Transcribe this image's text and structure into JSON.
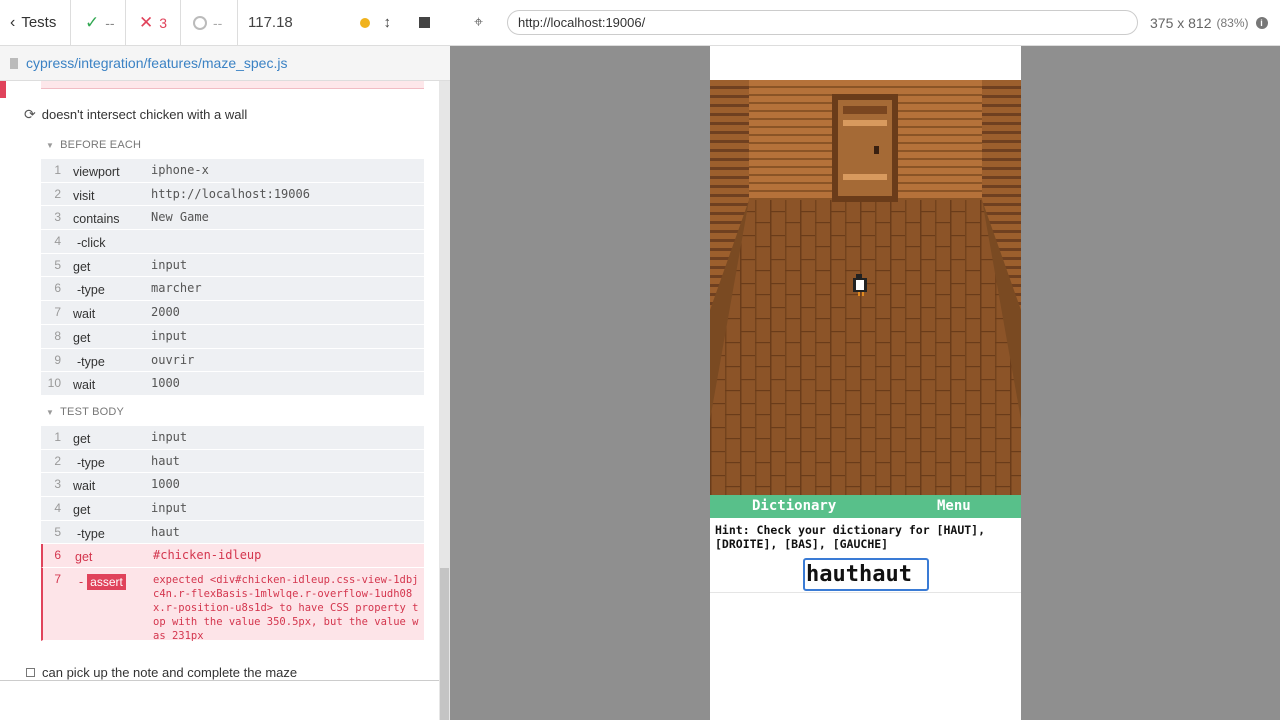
{
  "stats": {
    "tests_label": "Tests",
    "passed": "--",
    "failed": "3",
    "pending": "--",
    "duration": "117.18"
  },
  "spec": {
    "path": "cypress/integration/features/maze_spec.js"
  },
  "test": {
    "title": "doesn't intersect chicken with a wall",
    "before_each_label": "BEFORE EACH",
    "before_each": [
      {
        "num": "1",
        "name": "viewport",
        "msg": "iphone-x"
      },
      {
        "num": "2",
        "name": "visit",
        "msg": "http://localhost:19006"
      },
      {
        "num": "3",
        "name": "contains",
        "msg": "New Game"
      },
      {
        "num": "4",
        "name": "-click",
        "msg": ""
      },
      {
        "num": "5",
        "name": "get",
        "msg": "input"
      },
      {
        "num": "6",
        "name": "-type",
        "msg": "marcher"
      },
      {
        "num": "7",
        "name": "wait",
        "msg": "2000"
      },
      {
        "num": "8",
        "name": "get",
        "msg": "input"
      },
      {
        "num": "9",
        "name": "-type",
        "msg": "ouvrir"
      },
      {
        "num": "10",
        "name": "wait",
        "msg": "1000"
      }
    ],
    "body_label": "TEST BODY",
    "body": [
      {
        "num": "1",
        "name": "get",
        "msg": "input"
      },
      {
        "num": "2",
        "name": "-type",
        "msg": "haut"
      },
      {
        "num": "3",
        "name": "wait",
        "msg": "1000"
      },
      {
        "num": "4",
        "name": "get",
        "msg": "input"
      },
      {
        "num": "5",
        "name": "-type",
        "msg": "haut"
      },
      {
        "num": "6",
        "name": "get",
        "msg": "#chicken-idleup"
      },
      {
        "num": "7",
        "name": "-",
        "badge": "assert",
        "msg": "expected <div#chicken-idleup.css-view-1dbjc4n.r-flexBasis-1mlwlqe.r-overflow-1udh08x.r-position-u8s1d> to have CSS property top with the value 350.5px, but the value was 231px"
      }
    ]
  },
  "next_test": {
    "title": "can pick up the note and complete the maze"
  },
  "aut": {
    "url": "http://localhost:19006/",
    "viewport": "375 x 812",
    "scale": "(83%)"
  },
  "game": {
    "dictionary_label": "Dictionary",
    "menu_label": "Menu",
    "hint": "Hint: Check your dictionary for [HAUT], [DROITE], [BAS], [GAUCHE]",
    "input_value": "hauthaut"
  },
  "colors": {
    "fail_red": "#e0435b",
    "pass_green": "#32a852",
    "game_bar_green": "#58c08a",
    "link_blue": "#3b82c4"
  },
  "icons": [
    "chevron-left-icon",
    "check-icon",
    "cross-icon",
    "pending-ring-icon",
    "status-dot-icon",
    "resize-arrows-icon",
    "stop-icon",
    "file-icon",
    "refresh-icon",
    "selector-crosshair-icon",
    "info-icon"
  ]
}
